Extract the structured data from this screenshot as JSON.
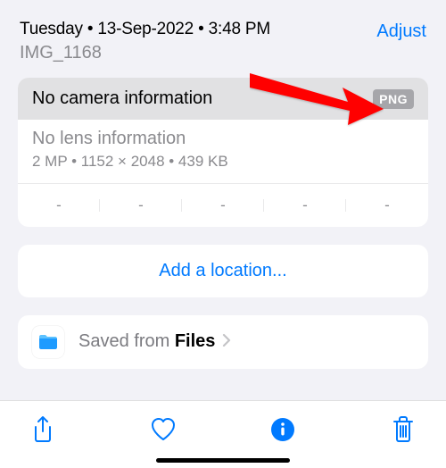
{
  "header": {
    "datetime": "Tuesday • 13-Sep-2022 • 3:48 PM",
    "filename": "IMG_1168",
    "adjust": "Adjust"
  },
  "camera": {
    "title": "No camera information",
    "badge": "PNG",
    "lens": "No lens information",
    "specs": "2 MP  •  1152 × 2048  •  439 KB"
  },
  "meta": [
    "-",
    "-",
    "-",
    "-",
    "-"
  ],
  "location": {
    "label": "Add a location..."
  },
  "saved": {
    "prefix": "Saved from ",
    "source": "Files"
  }
}
